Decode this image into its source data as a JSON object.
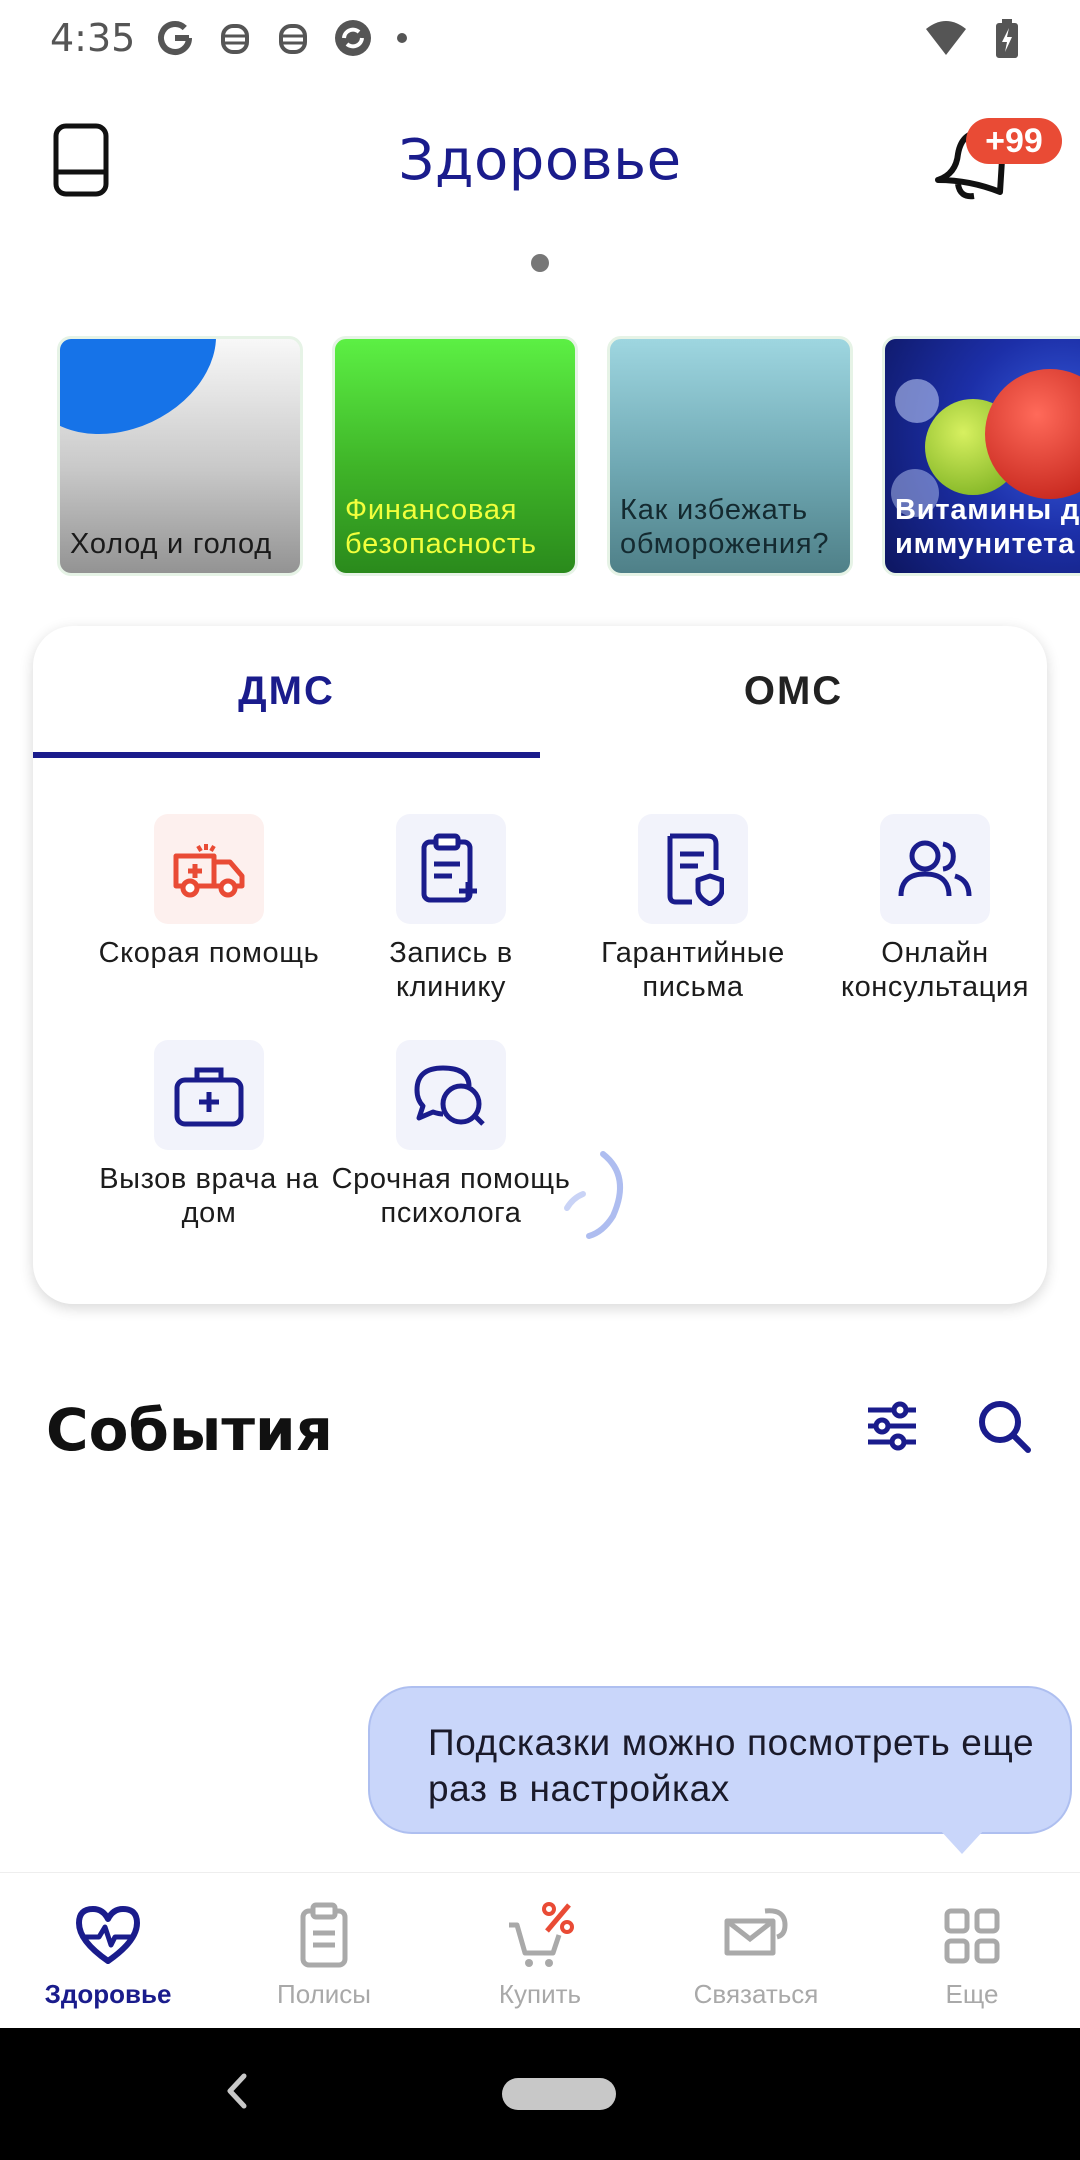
{
  "status_bar": {
    "time": "4:35",
    "left_icons": [
      "google-icon",
      "robot-icon",
      "robot-icon",
      "sync-icon",
      "dot-icon"
    ],
    "right_icons": [
      "wifi-icon",
      "battery-charging-icon"
    ]
  },
  "header": {
    "title": "Здоровье",
    "notification_badge": "+99"
  },
  "stories": [
    {
      "label": "Холод и голод"
    },
    {
      "label": "Финансовая безопасность"
    },
    {
      "label": "Как избежать обморожения?"
    },
    {
      "label": "Витамины для иммунитета"
    }
  ],
  "insurance": {
    "tabs": [
      {
        "label": "ДМС",
        "active": true
      },
      {
        "label": "ОМС",
        "active": false
      }
    ],
    "services": [
      {
        "label": "Скорая помощь",
        "icon": "ambulance-icon",
        "color": "#e94b35"
      },
      {
        "label": "Запись в клинику",
        "icon": "clipboard-plus-icon",
        "color": "#1a1c8c"
      },
      {
        "label": "Гарантийные письма",
        "icon": "document-shield-icon",
        "color": "#1a1c8c"
      },
      {
        "label": "Онлайн консультация",
        "icon": "users-icon",
        "color": "#1a1c8c"
      },
      {
        "label": "Вызов врача на дом",
        "icon": "medical-bag-icon",
        "color": "#1a1c8c"
      },
      {
        "label": "Срочная помощь психолога",
        "icon": "chat-bubbles-icon",
        "color": "#1a1c8c"
      }
    ]
  },
  "events": {
    "title": "События"
  },
  "hint": {
    "text": "Подсказки можно посмотреть еще раз в настройках"
  },
  "bottom_nav": [
    {
      "label": "Здоровье",
      "icon": "heart-pulse-icon",
      "active": true
    },
    {
      "label": "Полисы",
      "icon": "clipboard-icon",
      "active": false
    },
    {
      "label": "Купить",
      "icon": "cart-percent-icon",
      "active": false
    },
    {
      "label": "Связаться",
      "icon": "mail-chat-icon",
      "active": false
    },
    {
      "label": "Еще",
      "icon": "grid-icon",
      "active": false
    }
  ],
  "colors": {
    "brand": "#1a1c8c",
    "accent_red": "#e94b35",
    "hint_bg": "#c9d6fa",
    "inactive": "#a9a9a9"
  }
}
